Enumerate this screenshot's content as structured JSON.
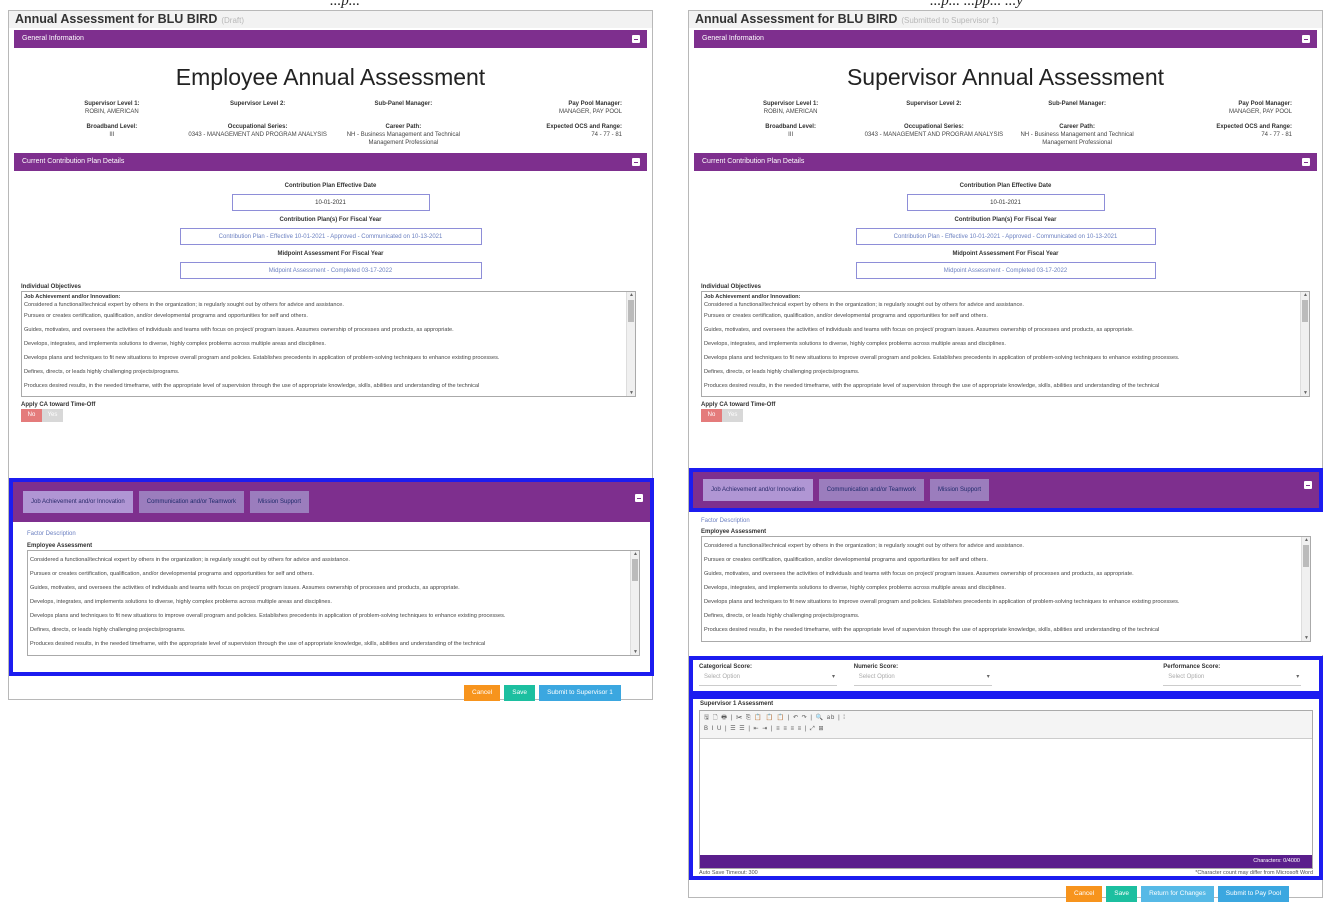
{
  "caption": {
    "left": "...p...",
    "right": "...p... ...pp... ...y"
  },
  "left": {
    "title": "Annual Assessment for BLU BIRD",
    "status": "(Draft)",
    "general_section": "General Information",
    "heading": "Employee Annual Assessment",
    "info": [
      {
        "label": "Supervisor Level 1:",
        "value": "ROBIN, AMERICAN"
      },
      {
        "label": "Supervisor Level 2:",
        "value": ""
      },
      {
        "label": "Sub-Panel Manager:",
        "value": ""
      },
      {
        "label": "Pay Pool Manager:",
        "value": "MANAGER, PAY POOL"
      },
      {
        "label": "Broadband Level:",
        "value": "III"
      },
      {
        "label": "Occupational Series:",
        "value": "0343 - MANAGEMENT AND PROGRAM ANALYSIS"
      },
      {
        "label": "Career Path:",
        "value": "NH - Business Management and Technical Management Professional"
      },
      {
        "label": "Expected OCS and Range:",
        "value": "74 - 77 - 81"
      }
    ],
    "contribution_section": "Current Contribution Plan Details",
    "effective_label": "Contribution Plan Effective Date",
    "effective_value": "10-01-2021",
    "plans_label": "Contribution Plan(s) For Fiscal Year",
    "plans_value": "Contribution Plan - Effective 10-01-2021 - Approved - Communicated on 10-13-2021",
    "midpoint_label": "Midpoint Assessment For Fiscal Year",
    "midpoint_value": "Midpoint Assessment - Completed 03-17-2022",
    "objectives_label": "Individual Objectives",
    "objectives_head": "Job Achievement and/or Innovation:",
    "objectives_lines": [
      "Considered a functional/technical expert by others in the organization; is regularly sought out by others for advice and assistance.",
      "Pursues or creates certification, qualification, and/or developmental programs and opportunities for self and others.",
      "Guides, motivates, and oversees the activities of individuals and teams with focus on project/ program issues. Assumes ownership of processes and products, as appropriate.",
      "Develops, integrates, and implements solutions to diverse, highly complex problems across multiple areas and disciplines.",
      "Develops plans and techniques to fit new situations to improve overall program and policies. Establishes precedents in application of problem-solving techniques to enhance existing processes.",
      "Defines, directs, or leads highly challenging projects/programs.",
      "Produces desired results, in the needed timeframe, with the appropriate level of supervision through the use of appropriate knowledge, skills, abilities and understanding of the technical"
    ],
    "apply_label": "Apply CA toward Time-Off",
    "toggle_no": "No",
    "toggle_yes": "Yes",
    "tabs": [
      "Job Achievement and/or Innovation",
      "Communication and/or Teamwork",
      "Mission Support"
    ],
    "factor_link": "Factor Description",
    "employee_label": "Employee Assessment",
    "employee_lines": [
      "Considered a functional/technical expert by others in the organization; is regularly sought out by others for advice and assistance.",
      "Pursues or creates certification, qualification, and/or developmental programs and opportunities for self and others.",
      "Guides, motivates, and oversees the activities of individuals and teams with focus on project/ program issues. Assumes ownership of processes and products, as appropriate.",
      "Develops, integrates, and implements solutions to diverse, highly complex problems across multiple areas and disciplines.",
      "Develops plans and techniques to fit new situations to improve overall program and policies. Establishes precedents in application of problem-solving techniques to enhance existing processes.",
      "Defines, directs, or leads highly challenging projects/programs.",
      "Produces desired results, in the needed timeframe, with the appropriate level of supervision through the use of appropriate knowledge, skills, abilities and understanding of the technical"
    ],
    "buttons": {
      "cancel": "Cancel",
      "save": "Save",
      "submit": "Submit to Supervisor 1"
    }
  },
  "right": {
    "title": "Annual Assessment for BLU BIRD",
    "status": "(Submitted to Supervisor 1)",
    "general_section": "General Information",
    "heading": "Supervisor Annual Assessment",
    "scores": {
      "categorical_label": "Categorical Score:",
      "numeric_label": "Numeric Score:",
      "performance_label": "Performance Score:",
      "placeholder": "Select Option"
    },
    "editor_label": "Supervisor 1 Assessment",
    "editor_toolbar_row1": "🖫 🗋 🖶 | ✂ ⎘ 📋 📋 📋 | ↶ ↷ | 🔍 ab | ⁞",
    "editor_toolbar_row2": "B I U | ☰ ☰ | ⇤ ⇥ | ≡ ≡ ≡ ≡ | ⤢ ⊞",
    "characters": "Characters: 0/4000",
    "autosave": "Auto Save Timeout: 300",
    "char_note": "*Character count may differ from Microsoft Word",
    "buttons": {
      "cancel": "Cancel",
      "save": "Save",
      "return": "Return for Changes",
      "submit": "Submit to Pay Pool"
    }
  },
  "colors": {
    "section_bar": "#7e2f8e",
    "highlight": "#1c1cf0",
    "cancel": "#f7941d",
    "save": "#1cbfa0",
    "submit": "#3ba7e0"
  }
}
